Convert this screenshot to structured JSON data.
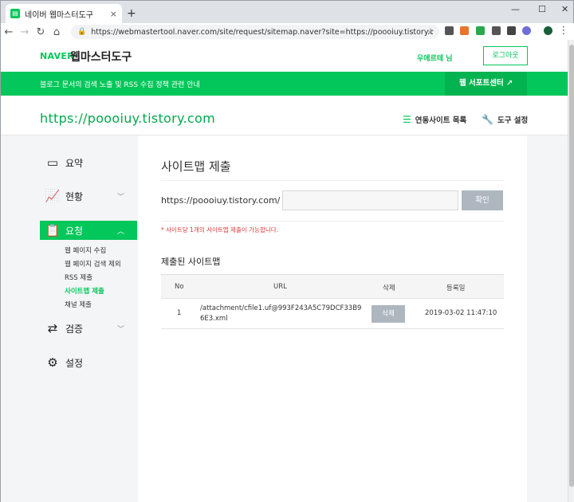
{
  "browser": {
    "tab_title": "네이버 웹마스터도구",
    "tab_close": "×",
    "new_tab": "+",
    "url": "https://webmastertool.naver.com/site/request/sitemap.naver?site=https://poooiuy.tistory.com",
    "window_controls": [
      "—",
      "☐",
      "✕"
    ]
  },
  "header": {
    "logo_naver": "NAVER",
    "logo_title": "웹마스터도구",
    "user_name": "우에르테 님",
    "logout": "로그아웃"
  },
  "banner": {
    "text": "블로그 문서의 검색 노출 및 RSS 수집 정책 관련 안내",
    "support": "웹 서포트센터 ↗"
  },
  "site": {
    "url": "https://poooiuy.tistory.com",
    "list_link": "연동사이트 목록",
    "tool_setting": "도구 설정"
  },
  "sidebar": {
    "summary": "요약",
    "status": "현황",
    "request": "요청",
    "sub_items": [
      "웹 페이지 수집",
      "웹 페이지 검색 제외",
      "RSS 제출",
      "사이트맵 제출",
      "채널 제출"
    ],
    "verify": "검증",
    "settings": "설정"
  },
  "content": {
    "title": "사이트맵 제출",
    "prefix": "https://poooiuy.tistory.com/",
    "input_value": "",
    "confirm": "확인",
    "notice": "* 사이트당 1개의 사이트맵 제출이 가능합니다.",
    "submitted_title": "제출된 사이트맵",
    "columns": {
      "no": "No",
      "url": "URL",
      "delete": "삭제",
      "date": "등록일"
    },
    "rows": [
      {
        "no": "1",
        "url": "/attachment/cfile1.uf@993F243A5C79DCF33B96E3.xml",
        "delete": "삭제",
        "date": "2019-03-02 11:47:10"
      }
    ]
  },
  "colors": {
    "accent": "#03c75a",
    "notice": "#e0363a",
    "button_gray": "#aeb6bf"
  }
}
